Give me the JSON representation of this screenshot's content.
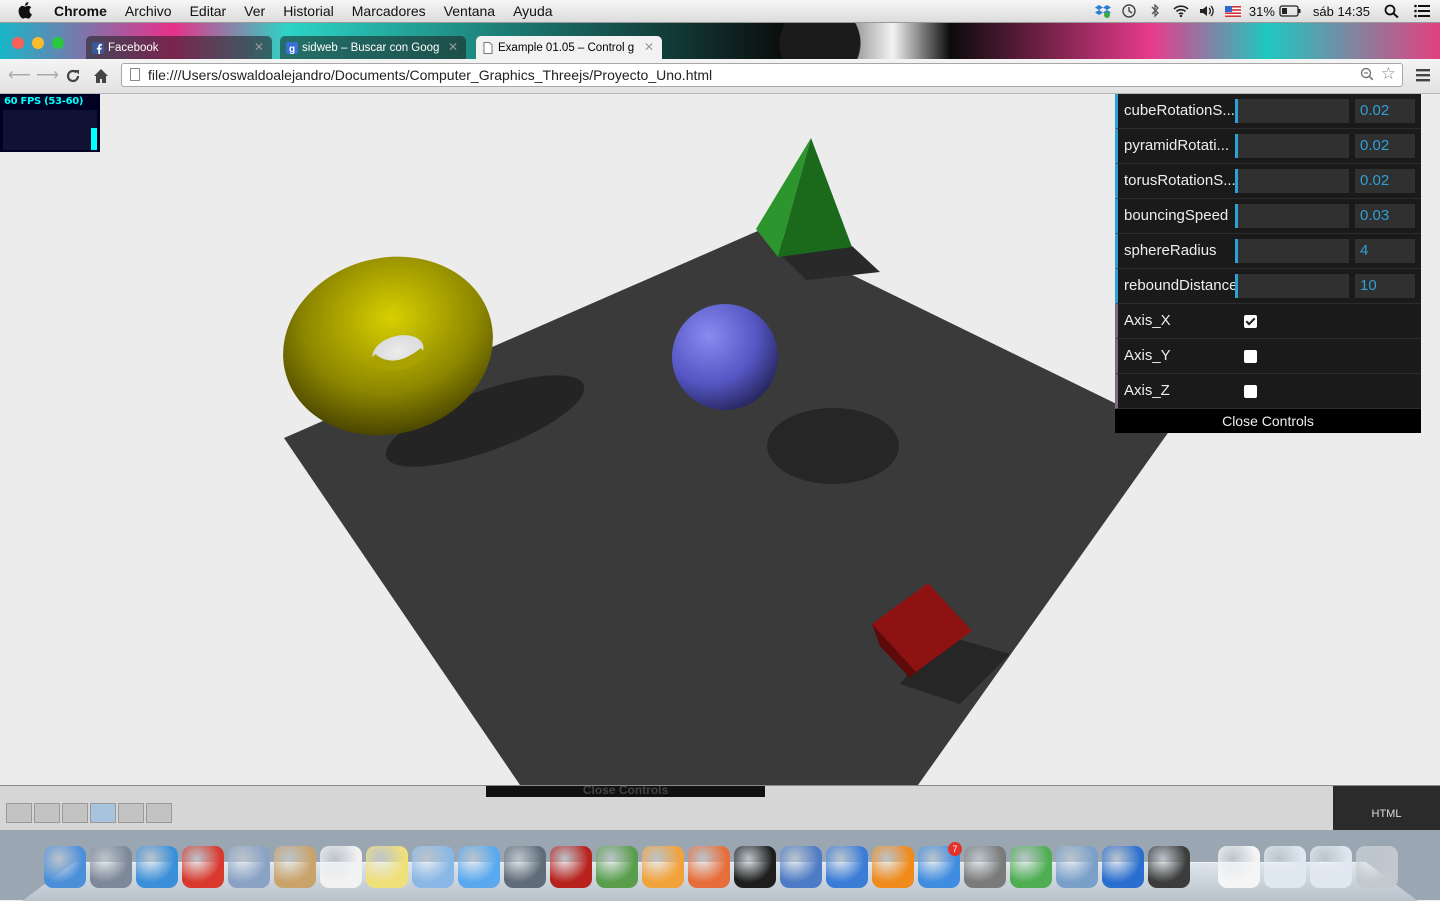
{
  "menubar": {
    "app_name": "Chrome",
    "menus": [
      "Archivo",
      "Editar",
      "Ver",
      "Historial",
      "Marcadores",
      "Ventana",
      "Ayuda"
    ],
    "battery": "31%",
    "clock": "sáb 14:35"
  },
  "tabs": [
    {
      "title": "Facebook",
      "icon": "facebook-icon",
      "active": false
    },
    {
      "title": "sidweb – Buscar con Goog",
      "icon": "google-icon",
      "active": false
    },
    {
      "title": "Example 01.05 – Control g",
      "icon": "page-icon",
      "active": true
    }
  ],
  "toolbar": {
    "url": "file:///Users/oswaldoalejandro/Documents/Computer_Graphics_Threejs/Proyecto_Uno.html"
  },
  "stats": {
    "fps_text": "60 FPS (53-60)",
    "fps_level": 0.55
  },
  "gui": {
    "controls": [
      {
        "label": "cubeRotationS...",
        "value": "0.02",
        "fill": 0.02
      },
      {
        "label": "pyramidRotati...",
        "value": "0.02",
        "fill": 0.02
      },
      {
        "label": "torusRotationS...",
        "value": "0.02",
        "fill": 0.02
      },
      {
        "label": "bouncingSpeed",
        "value": "0.03",
        "fill": 0.0
      },
      {
        "label": "sphereRadius",
        "value": "4",
        "fill": 0.0
      },
      {
        "label": "reboundDistance",
        "value": "10",
        "fill": 0.0
      }
    ],
    "checks": [
      {
        "label": "Axis_X",
        "checked": true
      },
      {
        "label": "Axis_Y",
        "checked": false
      },
      {
        "label": "Axis_Z",
        "checked": false
      }
    ],
    "close_label": "Close Controls"
  },
  "devtools": {
    "ghost_label": "Close Controls",
    "panel_label": "HTML"
  },
  "colors": {
    "accent": "#2fa1d6",
    "torus": "#b8b000",
    "sphere": "#6c6cd8",
    "pyramid": "#1f7f1f",
    "cube": "#8a1010",
    "plane": "#3a3a3a"
  },
  "dock": {
    "items": [
      {
        "icon": "finder-icon",
        "color": "#4b8fd9"
      },
      {
        "icon": "launchpad-icon",
        "color": "#7d8898"
      },
      {
        "icon": "safari-icon",
        "color": "#3b8fd9"
      },
      {
        "icon": "chrome-icon",
        "color": "#d9382c"
      },
      {
        "icon": "mail-stamp-icon",
        "color": "#8aa2c4"
      },
      {
        "icon": "contacts-icon",
        "color": "#c9a36a"
      },
      {
        "icon": "calendar-icon",
        "color": "#f2f2f2"
      },
      {
        "icon": "notes-icon",
        "color": "#f0e07a"
      },
      {
        "icon": "preview-icon",
        "color": "#89b8e6"
      },
      {
        "icon": "messages-icon",
        "color": "#5aa9ef"
      },
      {
        "icon": "facetime-icon",
        "color": "#5f6b78"
      },
      {
        "icon": "photo-booth-icon",
        "color": "#b8221d"
      },
      {
        "icon": "iphoto-icon",
        "color": "#5a9e4c"
      },
      {
        "icon": "pages-icon",
        "color": "#f2a23a"
      },
      {
        "icon": "numbers-icon",
        "color": "#e76e3a"
      },
      {
        "icon": "terminal-icon",
        "color": "#1e1e1e"
      },
      {
        "icon": "keynote-icon",
        "color": "#4e7bc5"
      },
      {
        "icon": "itunes-icon",
        "color": "#3a7cd6"
      },
      {
        "icon": "ibooks-icon",
        "color": "#f08a1a"
      },
      {
        "icon": "app-store-icon",
        "color": "#3f8ce0",
        "badge": "7"
      },
      {
        "icon": "system-preferences-icon",
        "color": "#7a7a7a"
      },
      {
        "icon": "messenger-icon",
        "color": "#4fae52"
      },
      {
        "icon": "network-icon",
        "color": "#7aa0c9"
      },
      {
        "icon": "word-icon",
        "color": "#2a6fcf"
      },
      {
        "icon": "sublime-icon",
        "color": "#3c3c3c"
      },
      {
        "icon": "document-icon",
        "color": "#f5f5f5"
      },
      {
        "icon": "window-icon",
        "color": "#dfe7f1"
      },
      {
        "icon": "window2-icon",
        "color": "#dfe7f1"
      },
      {
        "icon": "trash-icon",
        "color": "#c3c8ce"
      }
    ]
  }
}
